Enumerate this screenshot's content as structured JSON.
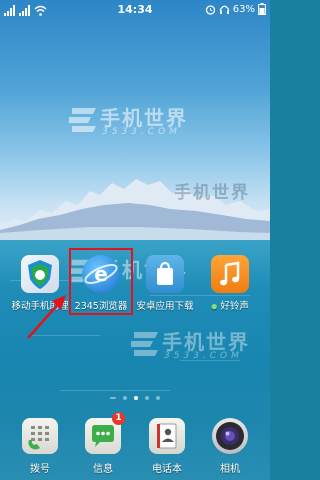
{
  "status_bar": {
    "time": "14:34",
    "battery": "63%"
  },
  "watermark": {
    "text": "手机世界",
    "subtext": "3533.COM"
  },
  "apps": [
    {
      "label": "移动手机助理",
      "icon": "shield-icon"
    },
    {
      "label": "2345浏览器",
      "icon": "browser-e-icon"
    },
    {
      "label": "安卓应用下载",
      "icon": "shopping-bag-icon"
    },
    {
      "label": "好铃声",
      "icon": "music-note-icon"
    }
  ],
  "dock": [
    {
      "label": "拨号",
      "icon": "phone-dial-icon"
    },
    {
      "label": "信息",
      "icon": "message-bubble-icon",
      "badge": "1"
    },
    {
      "label": "电话本",
      "icon": "contacts-book-icon"
    },
    {
      "label": "相机",
      "icon": "camera-icon"
    }
  ],
  "page_indicator": {
    "count": 5,
    "active": 2
  },
  "colors": {
    "highlight": "#e3131b",
    "badge": "#e8372b"
  }
}
